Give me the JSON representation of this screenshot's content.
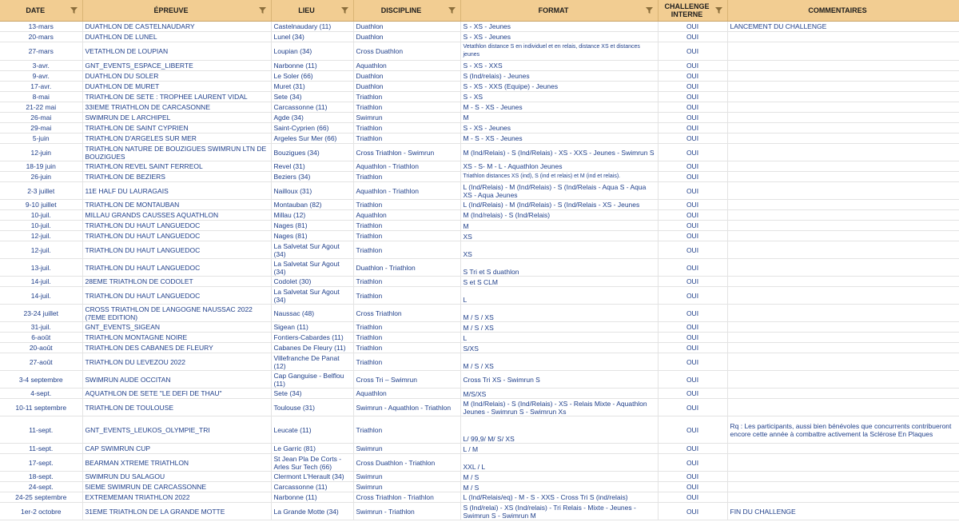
{
  "headers": [
    "DATE",
    "ÉPREUVE",
    "LIEU",
    "DISCIPLINE",
    "FORMAT",
    "CHALLENGE INTERNE",
    "COMMENTAIRES"
  ],
  "rows": [
    {
      "date": "13-mars",
      "epreuve": "DUATHLON DE CASTELNAUDARY",
      "lieu": "Castelnaudary (11)",
      "discipline": "Duathlon",
      "format": "S - XS - Jeunes",
      "challenge": "OUI",
      "commentaire": "LANCEMENT DU CHALLENGE"
    },
    {
      "date": "20-mars",
      "epreuve": "DUATHLON DE LUNEL",
      "lieu": "Lunel (34)",
      "discipline": "Duathlon",
      "format": "S - XS - Jeunes",
      "challenge": "OUI",
      "commentaire": ""
    },
    {
      "date": "27-mars",
      "epreuve": "VETATHLON DE LOUPIAN",
      "lieu": "Loupian (34)",
      "discipline": "Cross Duathlon",
      "format": "Vetathlon distance S en individuel et en relais, distance XS et distances jeunes",
      "challenge": "OUI",
      "commentaire": ""
    },
    {
      "date": "3-avr.",
      "epreuve": "GNT_EVENTS_ESPACE_LIBERTE",
      "lieu": "Narbonne (11)",
      "discipline": "Aquathlon",
      "format": "S - XS - XXS",
      "challenge": "OUI",
      "commentaire": ""
    },
    {
      "date": "9-avr.",
      "epreuve": "DUATHLON DU SOLER",
      "lieu": "Le Soler (66)",
      "discipline": "Duathlon",
      "format": "S (Ind/relais) - Jeunes",
      "challenge": "OUI",
      "commentaire": ""
    },
    {
      "date": "17-avr.",
      "epreuve": "DUATHLON DE MURET",
      "lieu": "Muret (31)",
      "discipline": "Duathlon",
      "format": "S - XS - XXS (Equipe) - Jeunes",
      "challenge": "OUI",
      "commentaire": ""
    },
    {
      "date": "8-mai",
      "epreuve": "TRIATHLON DE SETE : TROPHEE LAURENT VIDAL",
      "lieu": "Sete (34)",
      "discipline": "Triathlon",
      "format": "S - XS",
      "challenge": "OUI",
      "commentaire": ""
    },
    {
      "date": "21-22 mai",
      "epreuve": "33IEME TRIATHLON DE CARCASONNE",
      "lieu": "Carcassonne (11)",
      "discipline": "Triathlon",
      "format": "M - S - XS - Jeunes",
      "challenge": "OUI",
      "commentaire": ""
    },
    {
      "date": "26-mai",
      "epreuve": "SWIMRUN DE L ARCHIPEL",
      "lieu": "Agde (34)",
      "discipline": "Swimrun",
      "format": "M",
      "challenge": "OUI",
      "commentaire": ""
    },
    {
      "date": "29-mai",
      "epreuve": "TRIATHLON DE SAINT CYPRIEN",
      "lieu": "Saint-Cyprien (66)",
      "discipline": "Triathlon",
      "format": "S - XS - Jeunes",
      "challenge": "OUI",
      "commentaire": ""
    },
    {
      "date": "5-juin",
      "epreuve": "TRIATHLON D'ARGELES SUR MER",
      "lieu": "Argeles Sur Mer (66)",
      "discipline": "Triathlon",
      "format": "M - S - XS - Jeunes",
      "challenge": "OUI",
      "commentaire": ""
    },
    {
      "date": "12-juin",
      "epreuve": "TRIATHLON NATURE DE BOUZIGUES SWIMRUN LTN DE BOUZIGUES",
      "lieu": "Bouzigues (34)",
      "discipline": "Cross Triathlon - Swimrun",
      "format": "M (Ind/Relais) - S (Ind/Relais) - XS - XXS - Jeunes - Swimrun S",
      "challenge": "OUI",
      "commentaire": ""
    },
    {
      "date": "18-19 juin",
      "epreuve": "TRIATHLON REVEL SAINT FERREOL",
      "lieu": "Revel (31)",
      "discipline": "Aquathlon - Triathlon",
      "format": "XS - S- M - L - Aquathlon Jeunes",
      "challenge": "OUI",
      "commentaire": ""
    },
    {
      "date": "26-juin",
      "epreuve": "TRIATHLON DE BEZIERS",
      "lieu": "Beziers (34)",
      "discipline": "Triathlon",
      "format": "Triathlon distances XS (ind), S (ind et relais) et M (ind et relais).",
      "challenge": "OUI",
      "commentaire": ""
    },
    {
      "date": "2-3 juillet",
      "epreuve": "11E HALF DU LAURAGAIS",
      "lieu": "Nailloux (31)",
      "discipline": "Aquathlon - Triathlon",
      "format": "L (Ind/Relais) - M (Ind/Relais) - S (Ind/Relais - Aqua S - Aqua XS - Aqua Jeunes",
      "challenge": "OUI",
      "commentaire": ""
    },
    {
      "date": "9-10 juillet",
      "epreuve": "TRIATHLON DE MONTAUBAN",
      "lieu": "Montauban (82)",
      "discipline": "Triathlon",
      "format": "L (Ind/Relais) - M (Ind/Relais) - S (Ind/Relais - XS - Jeunes",
      "challenge": "OUI",
      "commentaire": ""
    },
    {
      "date": "10-juil.",
      "epreuve": "MILLAU GRANDS CAUSSES AQUATHLON",
      "lieu": "Millau (12)",
      "discipline": "Aquathlon",
      "format": "M (Ind/relais) - S (Ind/Relais)",
      "challenge": "OUI",
      "commentaire": ""
    },
    {
      "date": "10-juil.",
      "epreuve": "TRIATHLON DU HAUT LANGUEDOC",
      "lieu": "Nages (81)",
      "discipline": "Triathlon",
      "format": "M",
      "challenge": "OUI",
      "commentaire": ""
    },
    {
      "date": "12-juil.",
      "epreuve": "TRIATHLON DU HAUT LANGUEDOC",
      "lieu": "Nages (81)",
      "discipline": "Triathlon",
      "format": "XS",
      "challenge": "OUI",
      "commentaire": ""
    },
    {
      "date": "12-juil.",
      "epreuve": "TRIATHLON DU HAUT LANGUEDOC",
      "lieu": "La Salvetat Sur Agout (34)",
      "discipline": "Triathlon",
      "format": "XS",
      "challenge": "OUI",
      "commentaire": ""
    },
    {
      "date": "13-juil.",
      "epreuve": "TRIATHLON DU HAUT LANGUEDOC",
      "lieu": "La Salvetat Sur Agout (34)",
      "discipline": "Duathlon - Triathlon",
      "format": "S Tri et S duathlon",
      "challenge": "OUI",
      "commentaire": ""
    },
    {
      "date": "14-juil.",
      "epreuve": "28EME TRIATHLON DE CODOLET",
      "lieu": "Codolet (30)",
      "discipline": "Triathlon",
      "format": "S et S CLM",
      "challenge": "OUI",
      "commentaire": ""
    },
    {
      "date": "14-juil.",
      "epreuve": "TRIATHLON DU HAUT LANGUEDOC",
      "lieu": "La Salvetat Sur Agout (34)",
      "discipline": "Triathlon",
      "format": "L",
      "challenge": "OUI",
      "commentaire": ""
    },
    {
      "date": "23-24 juillet",
      "epreuve": "CROSS TRIATHLON DE LANGOGNE NAUSSAC 2022 (7EME EDITION)",
      "lieu": "Naussac (48)",
      "discipline": "Cross Triathlon",
      "format": "M / S / XS",
      "challenge": "OUI",
      "commentaire": ""
    },
    {
      "date": "31-juil.",
      "epreuve": "GNT_EVENTS_SIGEAN",
      "lieu": "Sigean (11)",
      "discipline": "Triathlon",
      "format": "M / S / XS",
      "challenge": "OUI",
      "commentaire": ""
    },
    {
      "date": "6-août",
      "epreuve": "TRIATHLON MONTAGNE NOIRE",
      "lieu": "Fontiers-Cabardes (11)",
      "discipline": "Triathlon",
      "format": "L",
      "challenge": "OUI",
      "commentaire": ""
    },
    {
      "date": "20-août",
      "epreuve": "TRIATHLON DES CABANES DE FLEURY",
      "lieu": "Cabanes De Fleury (11)",
      "discipline": "Triathlon",
      "format": "S/XS",
      "challenge": "OUI",
      "commentaire": ""
    },
    {
      "date": "27-août",
      "epreuve": "TRIATHLON DU LEVEZOU 2022",
      "lieu": "Villefranche De Panat (12)",
      "discipline": "Triathlon",
      "format": "M / S / XS",
      "challenge": "OUI",
      "commentaire": ""
    },
    {
      "date": "3-4 septembre",
      "epreuve": "SWIMRUN AUDE OCCITAN",
      "lieu": "Cap Ganguise - Belflou (11)",
      "discipline": "Cross Tri – Swimrun",
      "format": "Cross Tri XS - Swimrun S",
      "challenge": "OUI",
      "commentaire": ""
    },
    {
      "date": "4-sept.",
      "epreuve": "AQUATHLON DE SETE \"LE DEFI DE THAU\"",
      "lieu": "Sete (34)",
      "discipline": "Aquathlon",
      "format": "M/S/XS",
      "challenge": "OUI",
      "commentaire": ""
    },
    {
      "date": "10-11 septembre",
      "epreuve": "TRIATHLON DE TOULOUSE",
      "lieu": "Toulouse (31)",
      "discipline": "Swimrun - Aquathlon - Triathlon",
      "format": "M (Ind/Relais) - S (Ind/Relais) - XS - Relais Mixte - Aquathlon Jeunes - Swimrun S - Swimrun Xs",
      "challenge": "OUI",
      "commentaire": ""
    },
    {
      "date": "11-sept.",
      "epreuve": "GNT_EVENTS_LEUKOS_OLYMPIE_TRI",
      "lieu": "Leucate (11)",
      "discipline": "Triathlon",
      "format": "L/ 99,9/ M/  S/ XS",
      "challenge": "OUI",
      "commentaire": "Rq :  Les participants, aussi bien bénévoles que concurrents contribueront encore cette année à combattre activement la Sclérose En Plaques"
    },
    {
      "date": "11-sept.",
      "epreuve": "CAP SWIMRUN CUP",
      "lieu": "Le Garric (81)",
      "discipline": "Swimrun",
      "format": "L / M",
      "challenge": "OUI",
      "commentaire": ""
    },
    {
      "date": "17-sept.",
      "epreuve": "BEARMAN XTREME TRIATHLON",
      "lieu": "St Jean Pla De Corts - Arles Sur Tech (66)",
      "discipline": "Cross Duathlon - Triathlon",
      "format": "XXL / L",
      "challenge": "OUI",
      "commentaire": ""
    },
    {
      "date": "18-sept.",
      "epreuve": "SWIMRUN DU SALAGOU",
      "lieu": "Clermont L'Herault (34)",
      "discipline": "Swimrun",
      "format": "M / S",
      "challenge": "OUI",
      "commentaire": ""
    },
    {
      "date": "24-sept.",
      "epreuve": "5IEME SWIMRUN DE CARCASSONNE",
      "lieu": "Carcassonne (11)",
      "discipline": "Swimrun",
      "format": "M / S",
      "challenge": "OUI",
      "commentaire": ""
    },
    {
      "date": "24-25 septembre",
      "epreuve": "EXTREMEMAN TRIATHLON 2022",
      "lieu": "Narbonne (11)",
      "discipline": "Cross Triathlon - Triathlon",
      "format": "L (Ind/Relais/eq) - M - S - XXS - Cross Tri S (ind/relais)",
      "challenge": "OUI",
      "commentaire": ""
    },
    {
      "date": "1er-2 octobre",
      "epreuve": "31EME TRIATHLON DE LA GRANDE MOTTE",
      "lieu": "La Grande Motte (34)",
      "discipline": "Swimrun - Triathlon",
      "format": "S (Ind/relai) - XS (Ind/relais) - Tri Relais - Mixte - Jeunes - Swimrun S - Swimrun M",
      "challenge": "OUI",
      "commentaire": "FIN DU CHALLENGE"
    }
  ]
}
